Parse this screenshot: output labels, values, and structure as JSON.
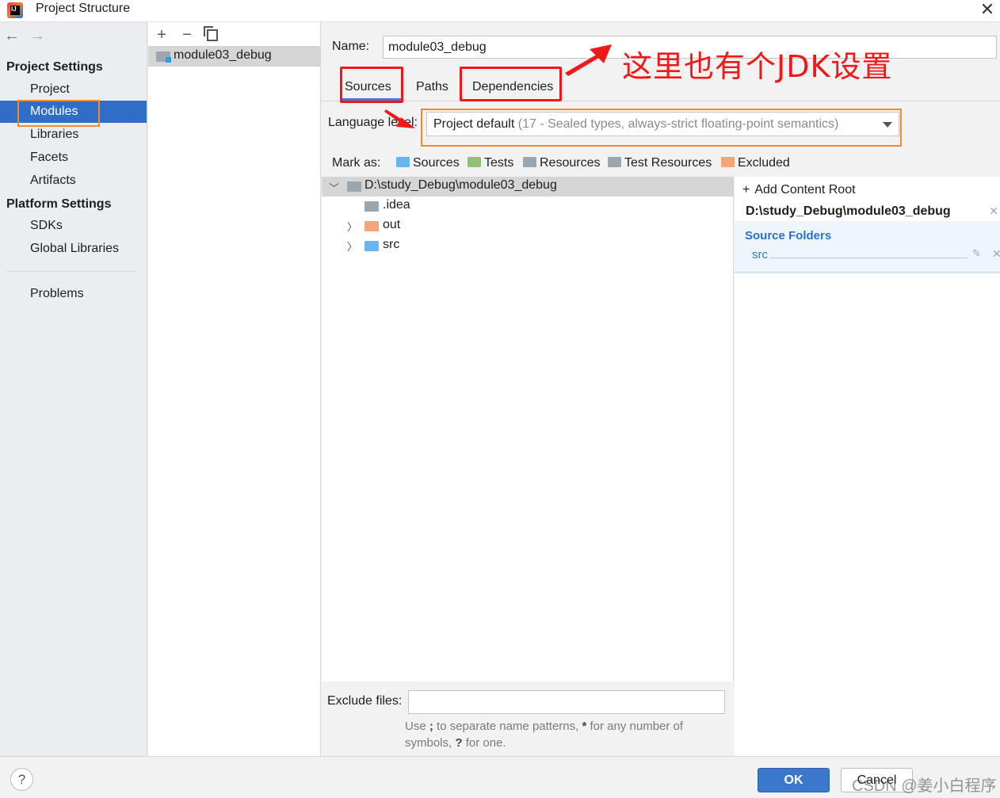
{
  "window": {
    "title": "Project Structure"
  },
  "sidebar": {
    "project_settings_header": "Project Settings",
    "platform_settings_header": "Platform Settings",
    "items": [
      {
        "label": "Project"
      },
      {
        "label": "Modules"
      },
      {
        "label": "Libraries"
      },
      {
        "label": "Facets"
      },
      {
        "label": "Artifacts"
      },
      {
        "label": "SDKs"
      },
      {
        "label": "Global Libraries"
      },
      {
        "label": "Problems"
      }
    ]
  },
  "modules_list": {
    "items": [
      {
        "label": "module03_debug"
      }
    ]
  },
  "main": {
    "name_label": "Name:",
    "name_value": "module03_debug",
    "tabs": [
      {
        "label": "Sources"
      },
      {
        "label": "Paths"
      },
      {
        "label": "Dependencies"
      }
    ],
    "language_level_label": "Language level:",
    "language_level_value": "Project default",
    "language_level_hint": "(17 - Sealed types, always-strict floating-point semantics)",
    "mark_as_label": "Mark as:",
    "mark_as": [
      {
        "label": "Sources",
        "color": "#66b7f0"
      },
      {
        "label": "Tests",
        "color": "#8fc276"
      },
      {
        "label": "Resources",
        "color": "#9aa7b0"
      },
      {
        "label": "Test Resources",
        "color": "#9aa7b0"
      },
      {
        "label": "Excluded",
        "color": "#f4a67a"
      }
    ],
    "tree": [
      {
        "label": "D:\\study_Debug\\module03_debug",
        "color": "#9aa7b0"
      },
      {
        "label": ".idea",
        "color": "#9aa7b0"
      },
      {
        "label": "out",
        "color": "#f4a67a"
      },
      {
        "label": "src",
        "color": "#66b7f0"
      }
    ],
    "right_panel": {
      "add_content_root": "Add Content Root",
      "root_path": "D:\\study_Debug\\module03_debug",
      "source_folders_label": "Source Folders",
      "source_folders": [
        "src"
      ]
    },
    "exclude_files_label": "Exclude files:",
    "exclude_files_value": "",
    "exclude_hint_1": "Use",
    "exclude_hint_semicolon": ";",
    "exclude_hint_2": "to separate name patterns,",
    "exclude_hint_star": "*",
    "exclude_hint_3": "for any number of symbols,",
    "exclude_hint_q": "?",
    "exclude_hint_4": "for one."
  },
  "buttons": {
    "help": "?",
    "ok": "OK",
    "cancel": "Cancel"
  },
  "annotation": {
    "text": "这里也有个JDK设置",
    "color": "#f01818"
  },
  "watermark": "CSDN @姜小白程序"
}
